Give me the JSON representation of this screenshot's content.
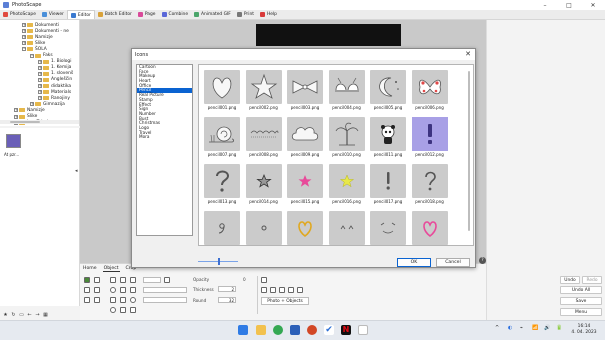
{
  "window": {
    "title": "PhotoScape",
    "controls": [
      "–",
      "□",
      "✕"
    ]
  },
  "tabs": [
    {
      "label": "PhotoScape",
      "color": "#e04a3f"
    },
    {
      "label": "Viewer",
      "color": "#4a8fd9"
    },
    {
      "label": "Editor",
      "color": "#3b7ad0"
    },
    {
      "label": "Batch Editor",
      "color": "#d9a23a"
    },
    {
      "label": "Page",
      "color": "#d94a9a"
    },
    {
      "label": "Combine",
      "color": "#5a67d8"
    },
    {
      "label": "Animated GIF",
      "color": "#4aa56a"
    },
    {
      "label": "Print",
      "color": "#777777"
    },
    {
      "label": "Help",
      "color": "#d93a3a"
    }
  ],
  "tree": [
    {
      "label": "Dokumenti",
      "expander": "+"
    },
    {
      "label": "Dokumenti - ne",
      "expander": "+"
    },
    {
      "label": "Namizje",
      "expander": "+"
    },
    {
      "label": "Slike",
      "expander": "+"
    },
    {
      "label": "ŠOLA",
      "expander": "−"
    },
    {
      "label": "Faks",
      "expander": "−"
    },
    {
      "label": "1. Biologi",
      "expander": "+"
    },
    {
      "label": "1. Kemija",
      "expander": "+"
    },
    {
      "label": "1. slovenš",
      "expander": "+"
    },
    {
      "label": "Angleščin",
      "expander": "+"
    },
    {
      "label": "didaktika",
      "expander": "+"
    },
    {
      "label": "Materials",
      "expander": "+"
    },
    {
      "label": "Ranojiny",
      "expander": "+"
    },
    {
      "label": "Gimnazija",
      "expander": "+"
    },
    {
      "label": "Namizje",
      "expander": "+"
    },
    {
      "label": "Slike",
      "expander": "+"
    },
    {
      "label": "Ima Tabula",
      "expander": "+"
    }
  ],
  "thumbnail": {
    "name": "At pzr..."
  },
  "dialog": {
    "title": "Icons",
    "close": "✕",
    "categories": [
      "Cartoon",
      "Face",
      "Makeup",
      "Heart",
      "Office",
      "Pencil",
      "Real Picture",
      "Stamp",
      "Effect",
      "Sign",
      "Number",
      "Bust",
      "Christmas",
      "Logo",
      "Travel",
      "Mora"
    ],
    "selected_category": "Pencil",
    "icons": [
      {
        "label": "pencil001.png",
        "glyph": "heart"
      },
      {
        "label": "pencil002.png",
        "glyph": "star"
      },
      {
        "label": "pencil003.png",
        "glyph": "bow"
      },
      {
        "label": "pencil004.png",
        "glyph": "bra"
      },
      {
        "label": "pencil005.png",
        "glyph": "moon"
      },
      {
        "label": "pencil006.png",
        "glyph": "butterfly"
      },
      {
        "label": "pencil007.png",
        "glyph": "snail"
      },
      {
        "label": "pencil008.png",
        "glyph": "lace"
      },
      {
        "label": "pencil009.png",
        "glyph": "cloud"
      },
      {
        "label": "pencil010.png",
        "glyph": "palm"
      },
      {
        "label": "pencil011.png",
        "glyph": "panda"
      },
      {
        "label": "pencil012.png",
        "glyph": "exclaim-purple"
      },
      {
        "label": "pencil013.png",
        "glyph": "question"
      },
      {
        "label": "pencil014.png",
        "glyph": "small-star"
      },
      {
        "label": "pencil015.png",
        "glyph": "pink-star"
      },
      {
        "label": "pencil016.png",
        "glyph": "yellow-star"
      },
      {
        "label": "pencil017.png",
        "glyph": "exclaim"
      },
      {
        "label": "pencil018.png",
        "glyph": "question2"
      },
      {
        "label": "pencil019.png",
        "glyph": "nine"
      },
      {
        "label": "pencil020.png",
        "glyph": "ring"
      },
      {
        "label": "pencil021.png",
        "glyph": "yellow-heart"
      },
      {
        "label": "pencil022.png",
        "glyph": "caret"
      },
      {
        "label": "pencil023.png",
        "glyph": "smile"
      },
      {
        "label": "pencil024.png",
        "glyph": "pink-heart"
      }
    ],
    "ok": "OK",
    "cancel": "Cancel"
  },
  "ribbon": {
    "tabs": [
      "Home",
      "Object",
      "Crop"
    ],
    "opacity_label": "Opacity",
    "opacity_value": "0",
    "thickness_label": "Thickness",
    "thickness_value": "2",
    "round_label": "Round",
    "round_value": "32",
    "photo_objects": "Photo + Objects"
  },
  "right_panel": {
    "undo": "Undo",
    "redo": "Redo",
    "undo_all": "Undo All",
    "save": "Save",
    "menu": "Menu"
  },
  "taskbar": {
    "time": "16:14",
    "date": "4. 04. 2023",
    "tray": [
      "^",
      "◐",
      "⌁",
      "📶",
      "🔊",
      "🔋"
    ]
  }
}
